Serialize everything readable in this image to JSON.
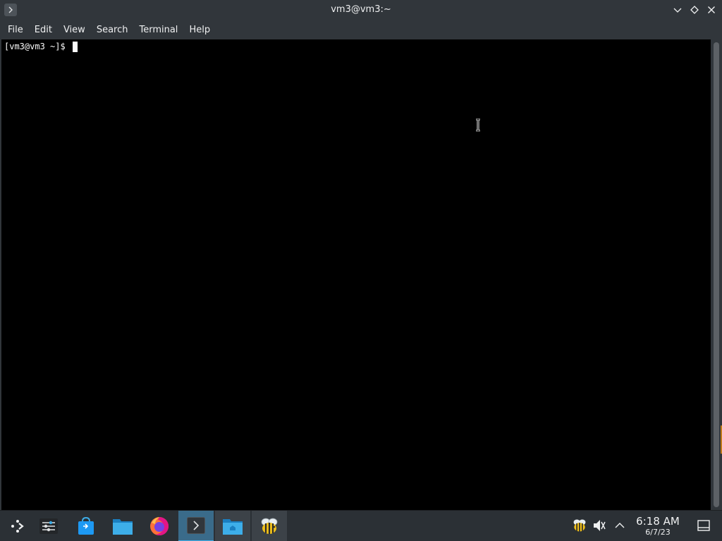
{
  "window": {
    "title": "vm3@vm3:~",
    "app_icon": "terminal-prompt-icon",
    "controls": [
      "minimize-icon",
      "maximize-icon",
      "close-icon"
    ]
  },
  "menu": {
    "items": [
      {
        "label": "File"
      },
      {
        "label": "Edit"
      },
      {
        "label": "View"
      },
      {
        "label": "Search"
      },
      {
        "label": "Terminal"
      },
      {
        "label": "Help"
      }
    ]
  },
  "terminal": {
    "prompt": "[vm3@vm3 ~]$ ",
    "background": "#000000",
    "foreground": "#fcfcfc"
  },
  "taskbar": {
    "launchers": [
      {
        "name": "application-launcher-icon"
      },
      {
        "name": "system-settings-icon"
      },
      {
        "name": "discover-store-icon"
      },
      {
        "name": "file-manager-icon"
      },
      {
        "name": "firefox-icon"
      },
      {
        "name": "terminal-icon"
      },
      {
        "name": "home-folder-icon"
      },
      {
        "name": "bee-app-icon"
      }
    ],
    "tray": [
      "bee-tray-icon",
      "volume-muted-icon",
      "expand-tray-icon"
    ],
    "clock": {
      "time": "6:18 AM",
      "date": "6/7/23"
    },
    "show_desktop": "show-desktop-icon",
    "accent": "#3daee9"
  }
}
